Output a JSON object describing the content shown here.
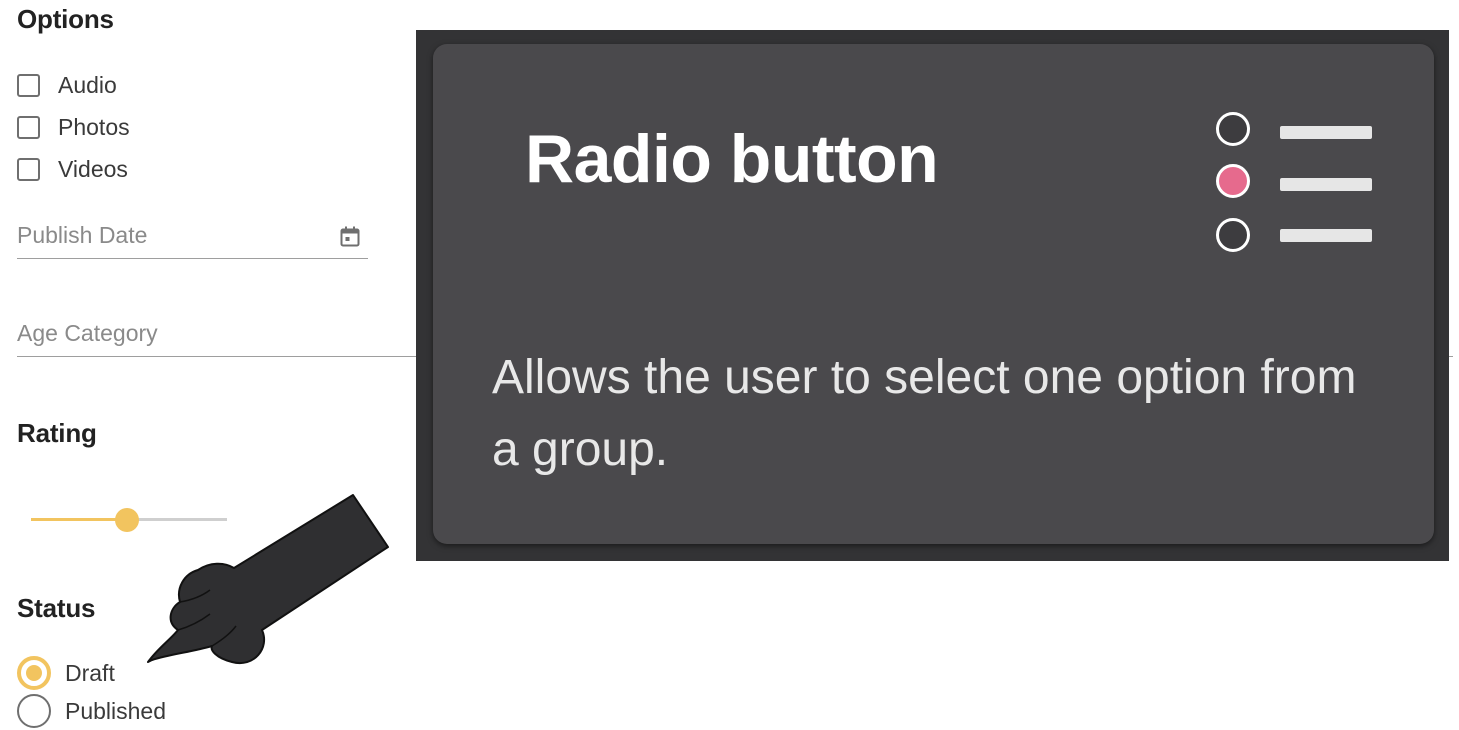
{
  "options": {
    "title": "Options",
    "items": [
      {
        "label": "Audio",
        "checked": false
      },
      {
        "label": "Photos",
        "checked": false
      },
      {
        "label": "Videos",
        "checked": false
      }
    ]
  },
  "publish_date": {
    "placeholder": "Publish Date",
    "icon": "calendar-icon"
  },
  "age_category": {
    "placeholder": "Age Category"
  },
  "rating": {
    "title": "Rating",
    "value_fraction": 0.49,
    "color": "#f2c45f"
  },
  "status": {
    "title": "Status",
    "items": [
      {
        "label": "Draft",
        "selected": true
      },
      {
        "label": "Published",
        "selected": false
      }
    ]
  },
  "overlay": {
    "title": "Radio button",
    "description": "Allows the user to select one option from a group.",
    "accent_color": "#e66a8d",
    "icon": "radio-list-icon"
  },
  "pointer": {
    "icon": "pointing-hand-icon"
  }
}
